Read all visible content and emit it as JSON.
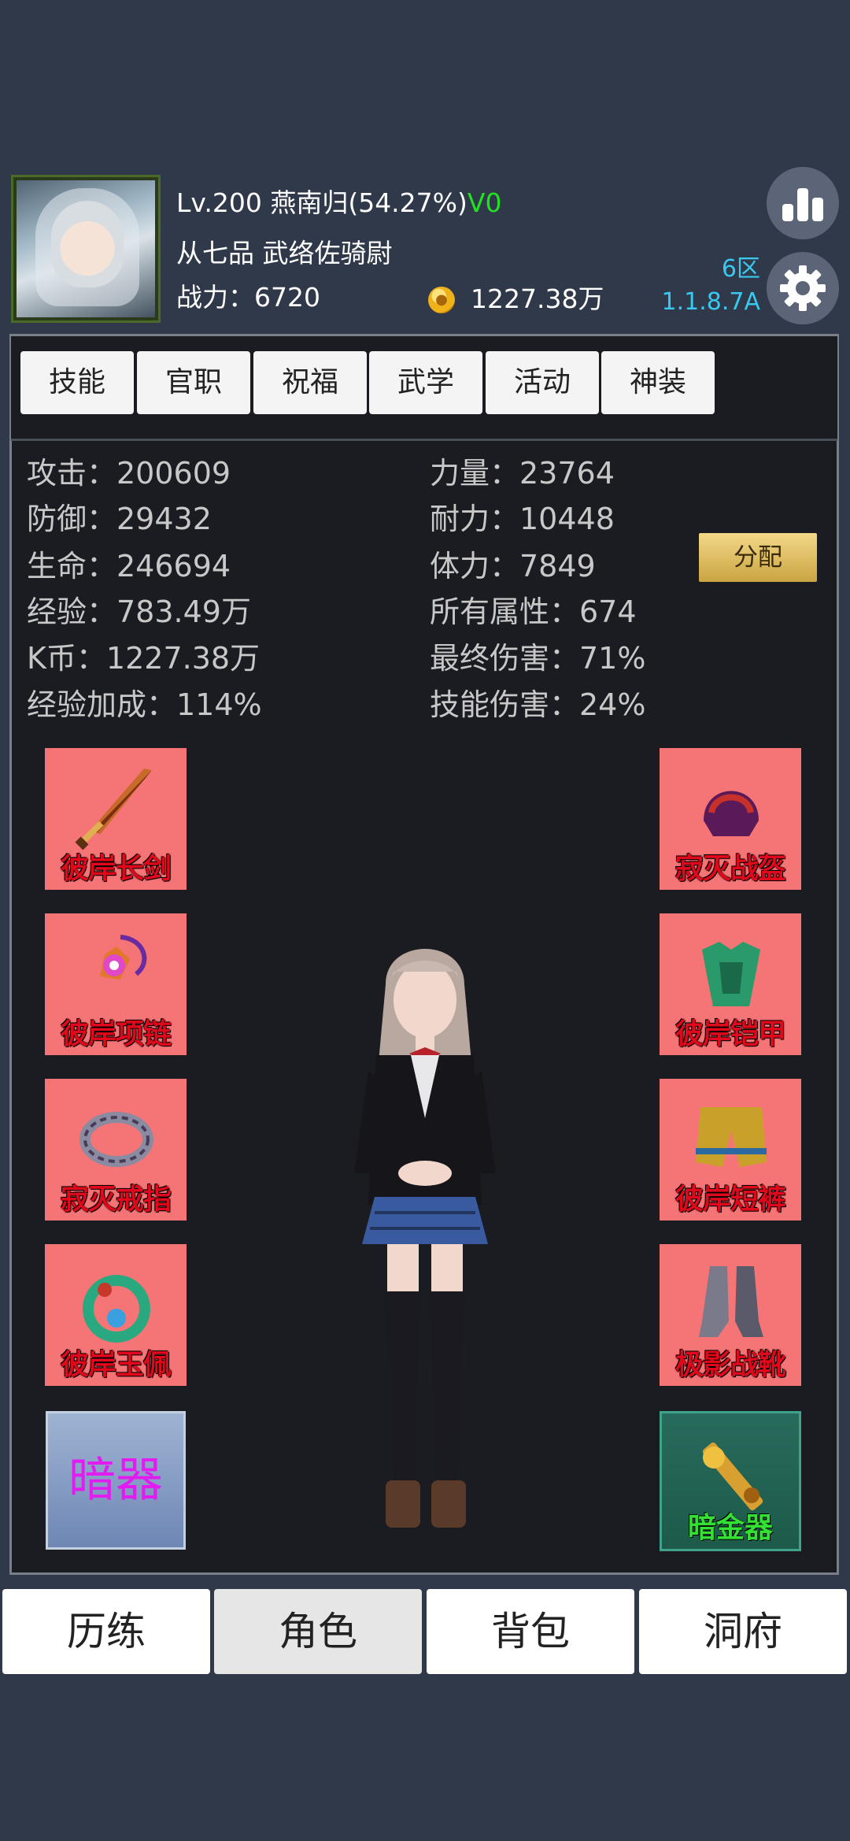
{
  "player": {
    "level_line": "Lv.200 燕南归(54.27%)",
    "vip": "V0",
    "rank_title": "从七品  武络佐骑尉",
    "power": "战力：6720",
    "coins": "1227.38万"
  },
  "server": {
    "zone": "6区",
    "version": "1.1.8.7A"
  },
  "icons": {
    "stats": "bar-chart-icon",
    "settings": "gear-icon",
    "coin": "gold-coin-icon"
  },
  "tabs": [
    "技能",
    "官职",
    "祝福",
    "武学",
    "活动",
    "神装"
  ],
  "stats_left": [
    "攻击：200609",
    "防御：29432",
    "生命：246694",
    "经验：783.49万",
    "K币：1227.38万",
    "经验加成：114%"
  ],
  "stats_right": [
    "力量：23764",
    "耐力：10448",
    "体力：7849",
    "所有属性：674",
    "最终伤害：71%",
    "技能伤害：24%"
  ],
  "allocate_label": "分配",
  "equipment_left": [
    "彼岸长剑",
    "彼岸项链",
    "寂灭戒指",
    "彼岸玉佩"
  ],
  "equipment_right": [
    "寂灭战盔",
    "彼岸铠甲",
    "彼岸短裤",
    "极影战靴"
  ],
  "hidden_weapon_label": "暗器",
  "hidden_gold_label": "暗金器",
  "nav": [
    "历练",
    "角色",
    "背包",
    "洞府"
  ],
  "nav_active": "角色",
  "colors": {
    "background": "#2f3949",
    "slot": "#f57576",
    "slot_label": "#e0081a",
    "vip": "#22e022",
    "server": "#39c8f0",
    "hidden_weapon_text": "#e21cf0"
  }
}
